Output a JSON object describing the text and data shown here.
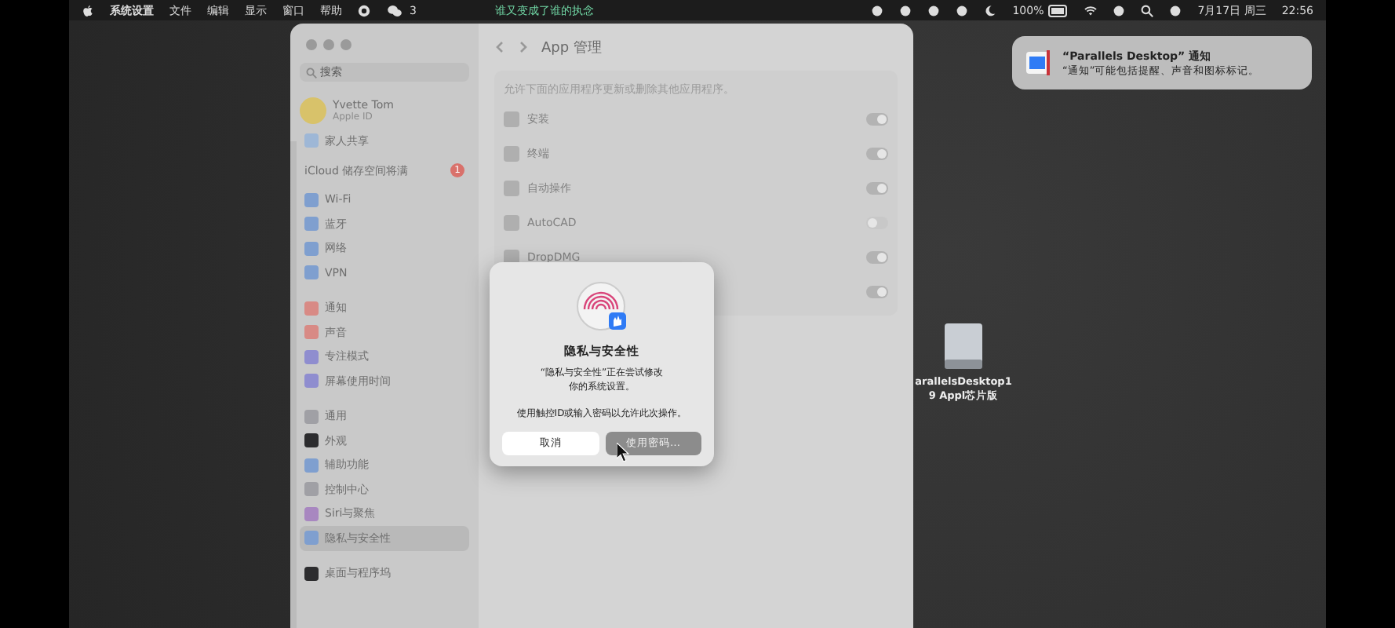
{
  "menu_bar": {
    "app_name": "系统设置",
    "menus": [
      "文件",
      "编辑",
      "显示",
      "窗口",
      "帮助"
    ],
    "wechat_count": "3",
    "now_playing": "谁又变成了谁的执念",
    "battery": "100%",
    "date": "7月17日 周三",
    "time": "22:56"
  },
  "sidebar": {
    "search": {
      "placeholder": "搜索"
    },
    "account": {
      "name": "Yvette Tom",
      "subtitle": "Apple ID"
    },
    "family": "家人共享",
    "icloud": {
      "label": "iCloud 储存空间将满",
      "badge": "1"
    },
    "groups": [
      [
        {
          "label": "Wi-Fi",
          "color": "#7f9fcf",
          "selected": false
        },
        {
          "label": "蓝牙",
          "color": "#7f9fcf",
          "selected": false
        },
        {
          "label": "网络",
          "color": "#7f9fcf",
          "selected": false
        },
        {
          "label": "VPN",
          "color": "#7f9fcf",
          "selected": false
        }
      ],
      [
        {
          "label": "通知",
          "color": "#d88a85",
          "selected": false
        },
        {
          "label": "声音",
          "color": "#d88a85",
          "selected": false
        },
        {
          "label": "专注模式",
          "color": "#8f8dcf",
          "selected": false
        },
        {
          "label": "屏幕使用时间",
          "color": "#8f8dcf",
          "selected": false
        }
      ],
      [
        {
          "label": "通用",
          "color": "#a0a0a5",
          "selected": false
        },
        {
          "label": "外观",
          "color": "#2c2c2e",
          "selected": false
        },
        {
          "label": "辅助功能",
          "color": "#7f9fcf",
          "selected": false
        },
        {
          "label": "控制中心",
          "color": "#a0a0a5",
          "selected": false
        },
        {
          "label": "Siri与聚焦",
          "color": "#a887c0",
          "selected": false
        },
        {
          "label": "隐私与安全性",
          "color": "#7f9fcf",
          "selected": true
        }
      ],
      [
        {
          "label": "桌面与程序坞",
          "color": "#2c2c2e",
          "selected": false
        }
      ]
    ]
  },
  "content": {
    "title": "App 管理",
    "description": "允许下面的应用程序更新或删除其他应用程序。",
    "apps": [
      {
        "label": "安装",
        "on": true
      },
      {
        "label": "终端",
        "on": true
      },
      {
        "label": "自动操作",
        "on": true
      },
      {
        "label": "AutoCAD",
        "on": false
      },
      {
        "label": "DropDMG",
        "on": true
      },
      {
        "on": true
      }
    ]
  },
  "dialog": {
    "title": "隐私与安全性",
    "message": "“隐私与安全性”正在尝试修改你的系统设置。",
    "prompt": "使用触控ID或输入密码以允许此次操作。",
    "buttons": [
      {
        "label": "取消",
        "kind": "cancel"
      },
      {
        "label": "使用密码…",
        "kind": "default"
      }
    ]
  },
  "notification": {
    "title": "“Parallels Desktop” 通知",
    "body": "“通知”可能包括提醒、声音和图标标记。"
  },
  "desktop_item": {
    "label": "arallelsDesktop19 Appl芯片版"
  }
}
